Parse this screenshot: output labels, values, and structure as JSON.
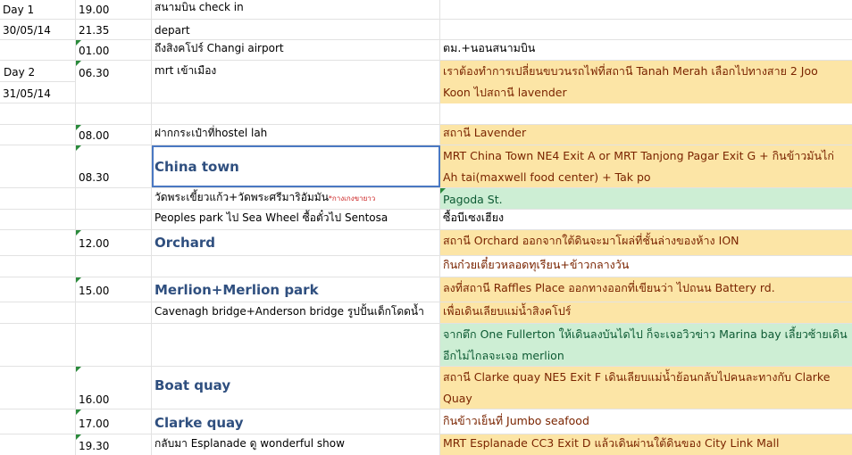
{
  "rows": [
    {
      "c0": "Day 1",
      "c1": "19.00",
      "c2": "สนามบิน check in",
      "c3": ""
    },
    {
      "c0": "30/05/14",
      "c1": "21.35",
      "c2": "depart",
      "c3": ""
    },
    {
      "c0": "",
      "c1": "01.00",
      "c2": "ถึงสิงคโปร์ Changi airport",
      "c3": "ตม.+นอนสนามบิน"
    },
    {
      "c0": "Day 2",
      "c1": "06.30",
      "c2": "mrt เข้าเมือง",
      "c3": "เราต้องทำการเปลี่ยนขบวนรถไฟที่สถานี Tanah Merah เลือกไปทางสาย 2 Joo Koon ไปสถานี lavender"
    },
    {
      "c0": "31/05/14"
    },
    {
      "c0": "",
      "c1": "",
      "c2": "",
      "c3": ""
    },
    {
      "c0": "",
      "c1": "08.00",
      "c2": "ฝากกระเป๋าที่hostel lah",
      "c3": "สถานี Lavender"
    },
    {
      "c0": "",
      "c1": "08.30",
      "c2": "China town",
      "c3": "MRT China Town NE4 Exit A or MRT Tanjong Pagar Exit G + กินข้าวมันไก่ Ah tai(maxwell food center) + Tak po"
    },
    {
      "c0": "",
      "c1": "",
      "c2": "วัดพระเขี้ยวแก้ว+วัดพระศรีมาริอัมมัน",
      "c2note": "*กางเกงขายาว",
      "c3": "Pagoda St."
    },
    {
      "c0": "",
      "c1": "",
      "c2": "Peoples park ไป Sea Wheel ซื้อตั๋วไป Sentosa",
      "c3": "ซื้อบีเซงเฮียง"
    },
    {
      "c0": "",
      "c1": "12.00",
      "c2": "Orchard",
      "c3": "สถานี Orchard ออกจากใต้ดินจะมาโผล่ที่ชั้นล่างของห้าง ION"
    },
    {
      "c0": "",
      "c1": "",
      "c2": "",
      "c3": "กินก๋วยเตี๋ยวหลอดทุเรียน+ข้าวกลางวัน"
    },
    {
      "c0": "",
      "c1": "15.00",
      "c2": "Merlion+Merlion park",
      "c3": "ลงที่สถานี Raffles Place ออกทางออกที่เขียนว่า ไปถนน Battery rd."
    },
    {
      "c0": "",
      "c1": "",
      "c2": "Cavenagh bridge+Anderson bridge รูปปั้นเด็กโดดน้ำ",
      "c3": "เพื่อเดินเลียบแม่น้ำสิงคโปร์"
    },
    {
      "c0": "",
      "c1": "",
      "c2": "",
      "c3": "จากตึก One Fullerton ให้เดินลงบันไดไป  ก็จะเจอวิวข่าว Marina bay เลี้ยวซ้ายเดินอีกไม่ไกลจะเจอ merlion"
    },
    {
      "c0": "",
      "c1": "16.00",
      "c2": "Boat quay",
      "c3": "สถานี Clarke quay NE5 Exit F เดินเลียบแม่น้ำย้อนกลับไปคนละทางกับ Clarke Quay"
    },
    {
      "c0": "",
      "c1": "17.00",
      "c2": "Clarke quay",
      "c3": "กินข้าวเย็นที่ Jumbo seafood"
    },
    {
      "c0": "",
      "c1": "19.30",
      "c2": "กลับมา Esplanade ดู wonderful show",
      "c3": "MRT Esplanade CC3 Exit D แล้วเดินผ่านใต้ดินของ City Link Mall"
    }
  ],
  "colors": {
    "orange": "#fce5a6",
    "green": "#cdeed4",
    "heading_blue": "#2f4f7f",
    "note_red": "#cc2222",
    "selection": "#4a78c2"
  }
}
